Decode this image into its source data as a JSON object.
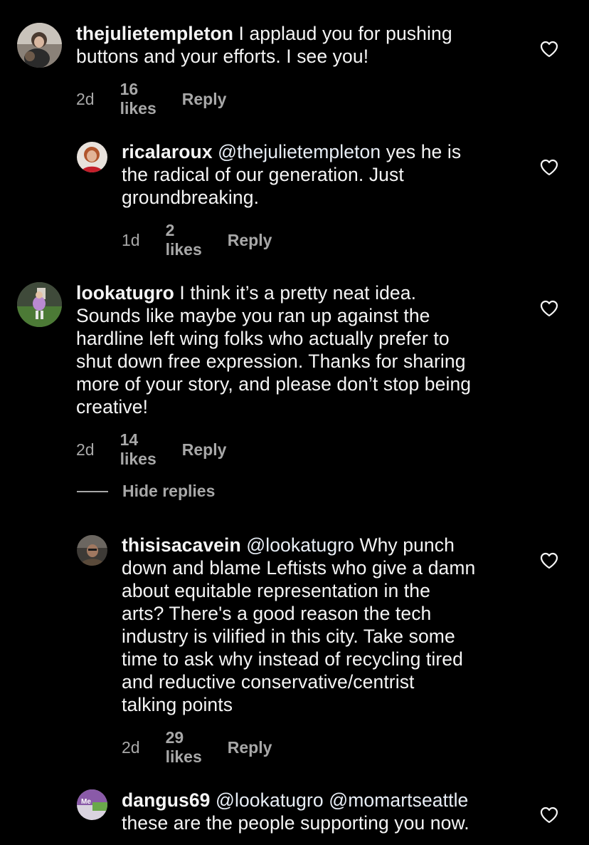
{
  "comments": [
    {
      "username": "thejulietempleton",
      "mention": "",
      "text_lines": [
        "I applaud you for pushing",
        "buttons and your efforts. I see you!"
      ],
      "age": "2d",
      "likes": "16 likes",
      "reply": "Reply"
    },
    {
      "username": "ricalaroux",
      "mention": "@thejulietempleton",
      "text_lines": [
        "yes he is",
        "the radical of our generation. Just",
        "groundbreaking."
      ],
      "age": "1d",
      "likes": "2 likes",
      "reply": "Reply"
    },
    {
      "username": "lookatugro",
      "mention": "",
      "text_lines": [
        "I think it’s a pretty neat idea.",
        "Sounds like maybe you ran up against the",
        "hardline left wing folks who actually prefer to",
        "shut down free expression. Thanks for sharing",
        "more of your story, and please don’t stop being",
        "creative!"
      ],
      "age": "2d",
      "likes": "14 likes",
      "reply": "Reply"
    },
    {
      "username": "thisisacavein",
      "mention": "@lookatugro",
      "text_lines": [
        "Why punch",
        "down and blame Leftists who give a damn",
        "about equitable representation in the",
        "arts? There's a good reason the tech",
        "industry is vilified in this city. Take some",
        "time to ask why instead of recycling tired",
        "and reductive conservative/centrist",
        "talking points"
      ],
      "age": "2d",
      "likes": "29 likes",
      "reply": "Reply"
    },
    {
      "username": "dangus69",
      "mention": "@lookatugro @momartseattle",
      "text_lines": [
        "",
        "these are the people supporting you now."
      ],
      "age": "",
      "likes": "",
      "reply": ""
    }
  ],
  "hide_replies": "Hide replies",
  "avatar_badge_text": "Me",
  "colors": {
    "background": "#000000",
    "text": "#f5f5f5",
    "meta": "#a8a8a8"
  },
  "icons": [
    "heart-icon"
  ]
}
